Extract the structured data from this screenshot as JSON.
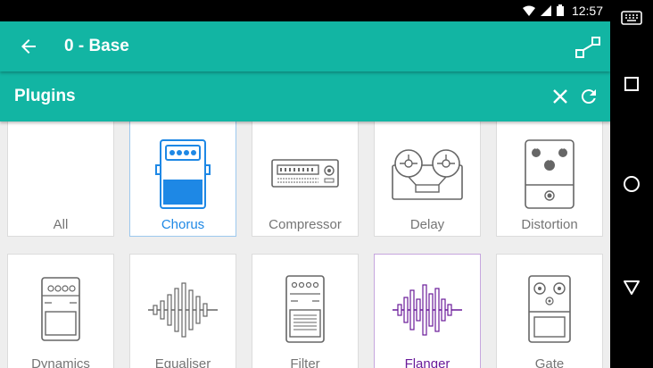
{
  "status_bar": {
    "time": "12:57",
    "icons": [
      "wifi-icon",
      "signal-icon",
      "battery-icon"
    ]
  },
  "app_bar": {
    "title": "0 - Base",
    "back_icon": "arrow-back-icon",
    "action_icon": "routing-icon"
  },
  "sub_bar": {
    "title": "Plugins",
    "close_icon": "close-icon",
    "refresh_icon": "refresh-icon"
  },
  "colors": {
    "primary": "#12b5a3",
    "selected_blue": "#1e88e5",
    "selected_purple": "#6a1b9a",
    "icon_gray": "#666666"
  },
  "plugins": [
    {
      "label": "All",
      "icon": "none",
      "selected": ""
    },
    {
      "label": "Chorus",
      "icon": "chorus-pedal-icon",
      "selected": "blue"
    },
    {
      "label": "Compressor",
      "icon": "compressor-rack-icon",
      "selected": ""
    },
    {
      "label": "Delay",
      "icon": "tape-delay-icon",
      "selected": ""
    },
    {
      "label": "Distortion",
      "icon": "distortion-pedal-icon",
      "selected": ""
    },
    {
      "label": "Dynamics",
      "icon": "dynamics-pedal-icon",
      "selected": ""
    },
    {
      "label": "Equaliser",
      "icon": "equaliser-wave-icon",
      "selected": ""
    },
    {
      "label": "Filter",
      "icon": "filter-pedal-icon",
      "selected": ""
    },
    {
      "label": "Flanger",
      "icon": "flanger-wave-icon",
      "selected": "purple"
    },
    {
      "label": "Gate",
      "icon": "gate-pedal-icon",
      "selected": ""
    }
  ],
  "nav_bar": {
    "icons": [
      "keyboard-icon",
      "recents-icon",
      "home-icon",
      "back-icon"
    ]
  }
}
